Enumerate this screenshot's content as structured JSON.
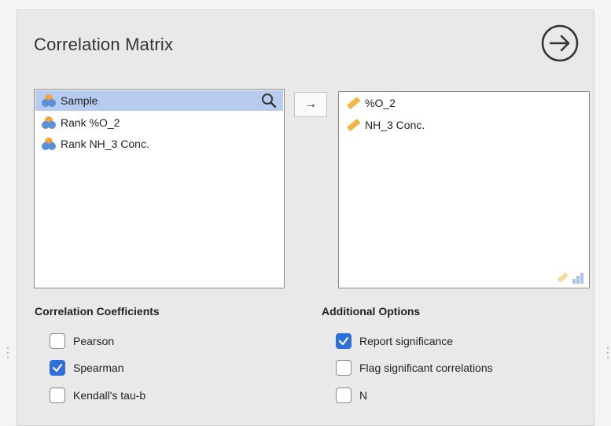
{
  "title": "Correlation Matrix",
  "variables": {
    "available": [
      {
        "label": "Sample",
        "icon": "nominal-icon",
        "selected": true
      },
      {
        "label": "Rank %O_2",
        "icon": "nominal-icon",
        "selected": false
      },
      {
        "label": "Rank NH_3 Conc.",
        "icon": "nominal-icon",
        "selected": false
      }
    ],
    "assigned": [
      {
        "label": "%O_2",
        "icon": "continuous-icon"
      },
      {
        "label": "NH_3 Conc.",
        "icon": "continuous-icon"
      }
    ]
  },
  "transfer_arrow": "→",
  "coefficients": {
    "heading": "Correlation Coefficients",
    "options": [
      {
        "label": "Pearson",
        "checked": false
      },
      {
        "label": "Spearman",
        "checked": true
      },
      {
        "label": "Kendall's tau-b",
        "checked": false
      }
    ]
  },
  "additional": {
    "heading": "Additional Options",
    "options": [
      {
        "label": "Report significance",
        "checked": true
      },
      {
        "label": "Flag significant correlations",
        "checked": false
      },
      {
        "label": "N",
        "checked": false
      }
    ]
  },
  "colors": {
    "accent": "#2f6fdc",
    "selection": "#b7cbee",
    "continuous_icon": "#f0b648",
    "nominal_icon_orange": "#f3a33a",
    "nominal_icon_blue": "#5b8fd9"
  }
}
